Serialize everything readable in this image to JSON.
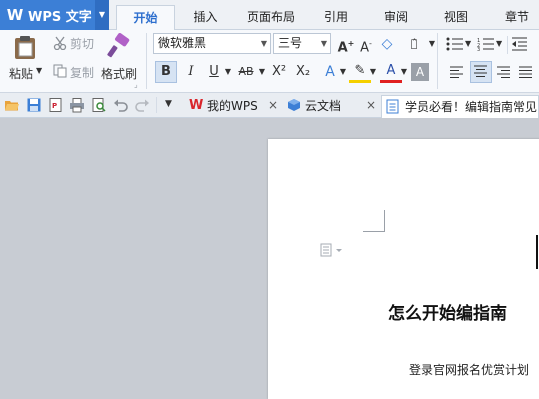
{
  "app": {
    "name": "WPS 文字"
  },
  "ribbon_tabs": [
    "开始",
    "插入",
    "页面布局",
    "引用",
    "审阅",
    "视图",
    "章节"
  ],
  "clipboard": {
    "paste": "粘贴",
    "cut": "剪切",
    "copy": "复制",
    "format_painter": "格式刷"
  },
  "font": {
    "family": "微软雅黑",
    "size": "三号"
  },
  "format_buttons": {
    "bold": "B",
    "italic": "I",
    "underline": "U",
    "strike": "AB",
    "superscript": "X²",
    "subscript": "X₂"
  },
  "doc_tabs": [
    {
      "label": "我的WPS"
    },
    {
      "label": "云文档"
    },
    {
      "label": "学员必看！编辑指南常见问"
    }
  ],
  "document": {
    "title": "怎么开始编指南",
    "line1": "登录官网报名优赏计划"
  },
  "colors": {
    "accent": "#3c7fd6",
    "workspace": "#c8ccd3"
  }
}
